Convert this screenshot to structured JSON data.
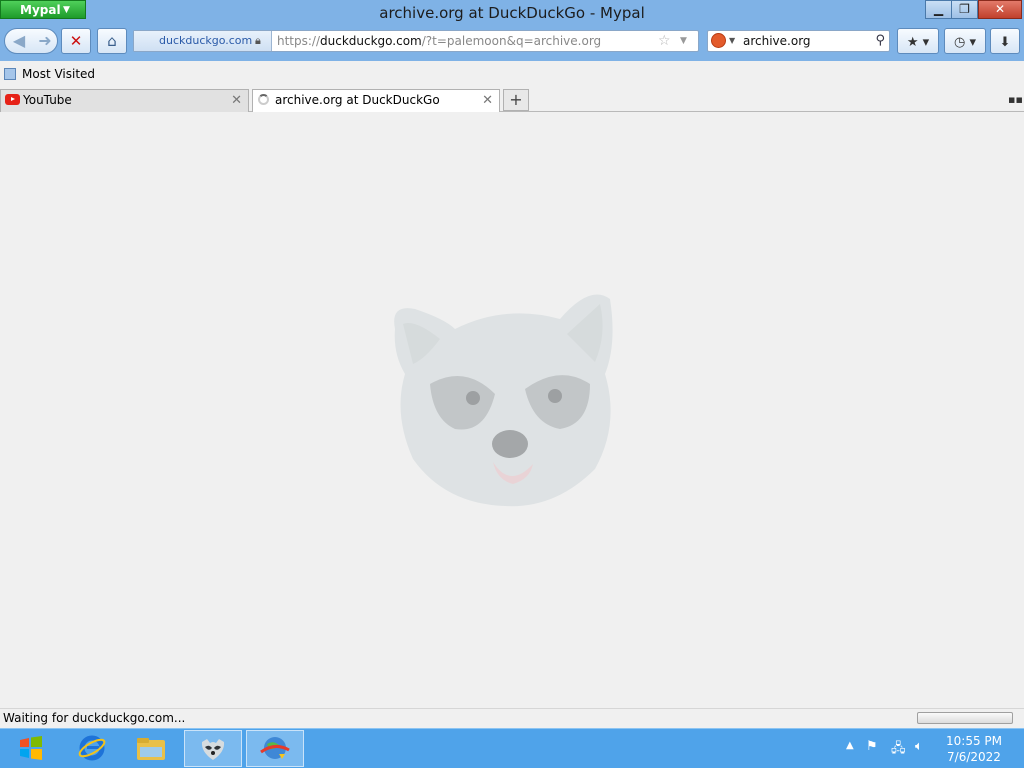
{
  "window": {
    "app_menu_label": "Mypal",
    "title": "archive.org at DuckDuckGo - Mypal"
  },
  "navbar": {
    "identity_label": "duckduckgo.com",
    "url_prefix": "https://",
    "url_host": "duckduckgo.com",
    "url_path": "/?t=palemoon&q=archive.org",
    "search_value": "archive.org"
  },
  "bookmarks": {
    "items": [
      {
        "label": "Most Visited"
      }
    ]
  },
  "tabs": [
    {
      "label": "YouTube",
      "active": false
    },
    {
      "label": "archive.org at DuckDuckGo",
      "active": true,
      "loading": true
    }
  ],
  "status": {
    "text": "Waiting for duckduckgo.com..."
  },
  "taskbar": {
    "time": "10:55 PM",
    "date": "7/6/2022"
  },
  "colors": {
    "titlebar": "#7fb2e6",
    "taskbar": "#4fa3ea",
    "content_bg": "#f0f0f0"
  }
}
